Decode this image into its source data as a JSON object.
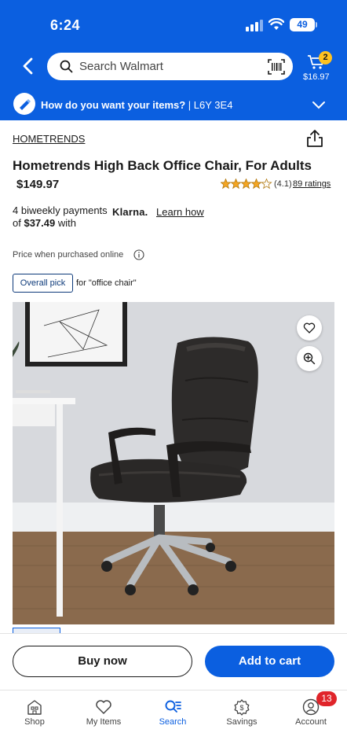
{
  "status_bar": {
    "time": "6:24",
    "battery": "49"
  },
  "header": {
    "search_placeholder": "Search Walmart",
    "cart_count": "2",
    "cart_total": "$16.97"
  },
  "delivery": {
    "prompt": "How do you want your items?",
    "postal": " | L6Y 3E4"
  },
  "product": {
    "brand": "HOMETRENDS",
    "title": "Hometrends High Back Office Chair, For Adults",
    "price": "$149.97",
    "rating_value": 4.1,
    "rating_text": "(4.1)",
    "ratings_link": "89 ratings",
    "klarna_prefix": "4 biweekly payments of ",
    "klarna_amount": "$37.49",
    "klarna_suffix": " with",
    "klarna_brand": "Klarna.",
    "learn_how": "Learn how",
    "price_note": "Price when purchased online",
    "pick_badge": "Overall pick",
    "pick_for": "for \"office chair\""
  },
  "actions": {
    "buy_now": "Buy now",
    "add_to_cart": "Add to cart"
  },
  "bottom_nav": {
    "items": [
      {
        "label": "Shop",
        "icon": "shop-icon"
      },
      {
        "label": "My Items",
        "icon": "heart-icon"
      },
      {
        "label": "Search",
        "icon": "search-list-icon"
      },
      {
        "label": "Savings",
        "icon": "savings-icon"
      },
      {
        "label": "Account",
        "icon": "account-icon"
      }
    ],
    "active": "Search",
    "account_badge": "13"
  },
  "colors": {
    "brand_blue": "#0b5fe0",
    "star": "#f5a623",
    "badge_yellow": "#ffc220",
    "alert_red": "#e0242a"
  }
}
